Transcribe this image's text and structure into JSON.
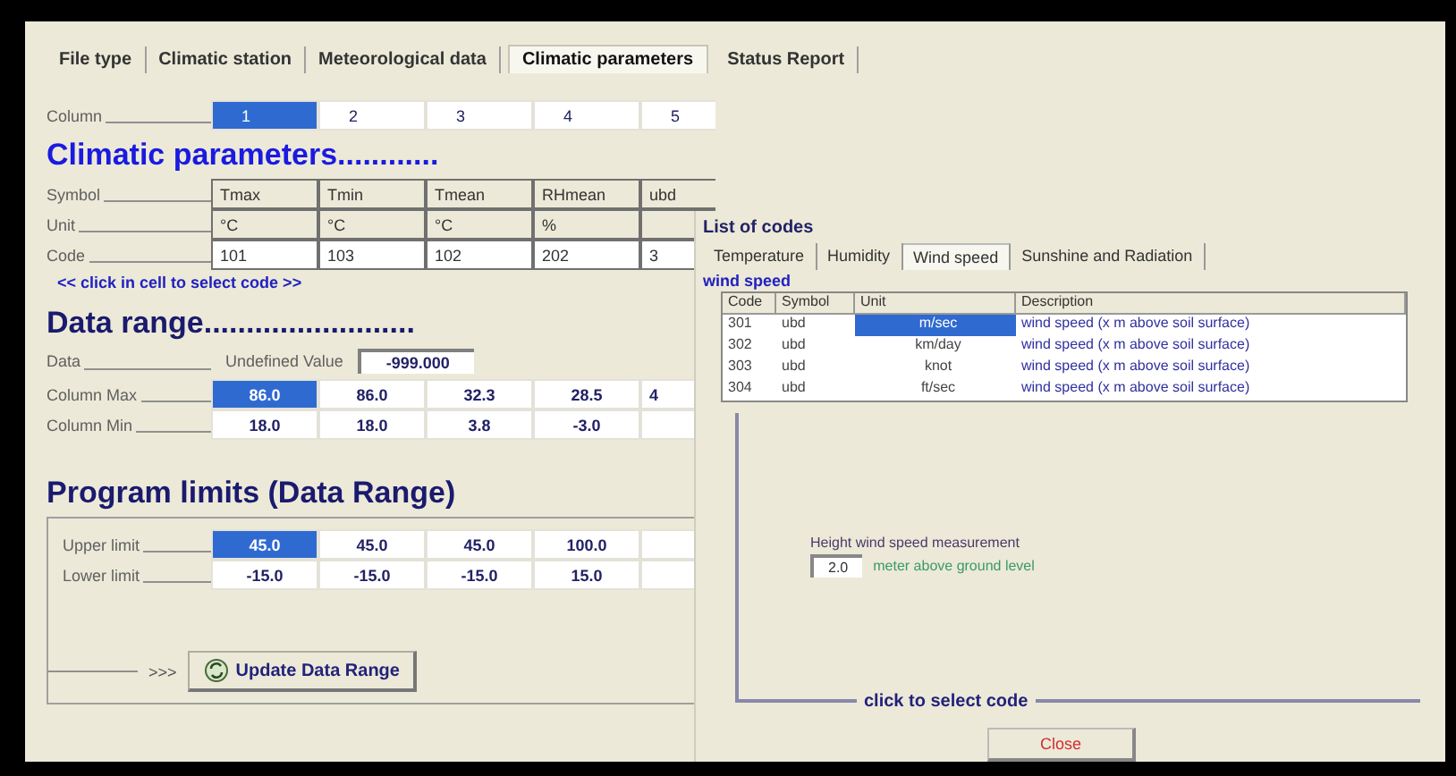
{
  "tabs": [
    {
      "label": "File type",
      "selected": false
    },
    {
      "label": "Climatic station",
      "selected": false
    },
    {
      "label": "Meteorological data",
      "selected": false
    },
    {
      "label": "Climatic parameters",
      "selected": true
    },
    {
      "label": "Status Report",
      "selected": false
    }
  ],
  "column_row": {
    "label": "Column",
    "cells": [
      {
        "text": "1",
        "selected": true
      },
      {
        "text": "2",
        "selected": false
      },
      {
        "text": "3",
        "selected": false
      },
      {
        "text": "4",
        "selected": false
      },
      {
        "text": "5",
        "selected": false
      }
    ]
  },
  "climatic_parameters": {
    "heading": "Climatic parameters............",
    "rows": [
      {
        "label": "Symbol",
        "cells": [
          "Tmax",
          "Tmin",
          "Tmean",
          "RHmean",
          "ubd"
        ]
      },
      {
        "label": "Unit",
        "cells": [
          "°C",
          "°C",
          "°C",
          "%"
        ]
      },
      {
        "label": "Code",
        "cells": [
          "101",
          "103",
          "102",
          "202",
          "3"
        ]
      }
    ],
    "hint": "<< click in cell to select code >>"
  },
  "data_range": {
    "heading": "Data range.........................",
    "data_label": "Data",
    "undefined_label": "Undefined Value",
    "undefined_value": "-999.000",
    "rows": [
      {
        "label": "Column Max",
        "cells": [
          {
            "text": "86.0",
            "selected": true
          },
          {
            "text": "86.0",
            "selected": false
          },
          {
            "text": "32.3",
            "selected": false
          },
          {
            "text": "28.5",
            "selected": false
          },
          {
            "text": "4",
            "selected": false
          }
        ]
      },
      {
        "label": "Column Min",
        "cells": [
          {
            "text": "18.0",
            "selected": false
          },
          {
            "text": "18.0",
            "selected": false
          },
          {
            "text": "3.8",
            "selected": false
          },
          {
            "text": "-3.0",
            "selected": false
          }
        ]
      }
    ]
  },
  "program_limits": {
    "heading": "Program limits (Data Range)",
    "rows": [
      {
        "label": "Upper limit",
        "cells": [
          {
            "text": "45.0",
            "selected": true
          },
          {
            "text": "45.0",
            "selected": false
          },
          {
            "text": "45.0",
            "selected": false
          },
          {
            "text": "100.0",
            "selected": false
          }
        ]
      },
      {
        "label": "Lower limit",
        "cells": [
          {
            "text": "-15.0",
            "selected": false
          },
          {
            "text": "-15.0",
            "selected": false
          },
          {
            "text": "-15.0",
            "selected": false
          },
          {
            "text": "15.0",
            "selected": false
          }
        ]
      }
    ],
    "arrow": ">>>",
    "button": "Update Data Range"
  },
  "dialog": {
    "title": "List of codes",
    "tabs": [
      {
        "label": "Temperature",
        "selected": false
      },
      {
        "label": "Humidity",
        "selected": false
      },
      {
        "label": "Wind speed",
        "selected": true
      },
      {
        "label": "Sunshine and Radiation",
        "selected": false
      }
    ],
    "section": "wind speed",
    "columns": [
      "Code",
      "Symbol",
      "Unit",
      "Description"
    ],
    "rows": [
      {
        "code": "301",
        "symbol": "ubd",
        "unit": "m/sec",
        "description": "wind speed (x m above soil surface)",
        "selected": true
      },
      {
        "code": "302",
        "symbol": "ubd",
        "unit": "km/day",
        "description": "wind speed (x m above soil surface)",
        "selected": false
      },
      {
        "code": "303",
        "symbol": "ubd",
        "unit": "knot",
        "description": "wind speed (x m above soil surface)",
        "selected": false
      },
      {
        "code": "304",
        "symbol": "ubd",
        "unit": "ft/sec",
        "description": "wind speed (x m above soil surface)",
        "selected": false
      }
    ],
    "height_label": "Height wind speed measurement",
    "height_value": "2.0",
    "height_unit": "meter above ground level",
    "hint": "click to select code",
    "close": "Close"
  }
}
